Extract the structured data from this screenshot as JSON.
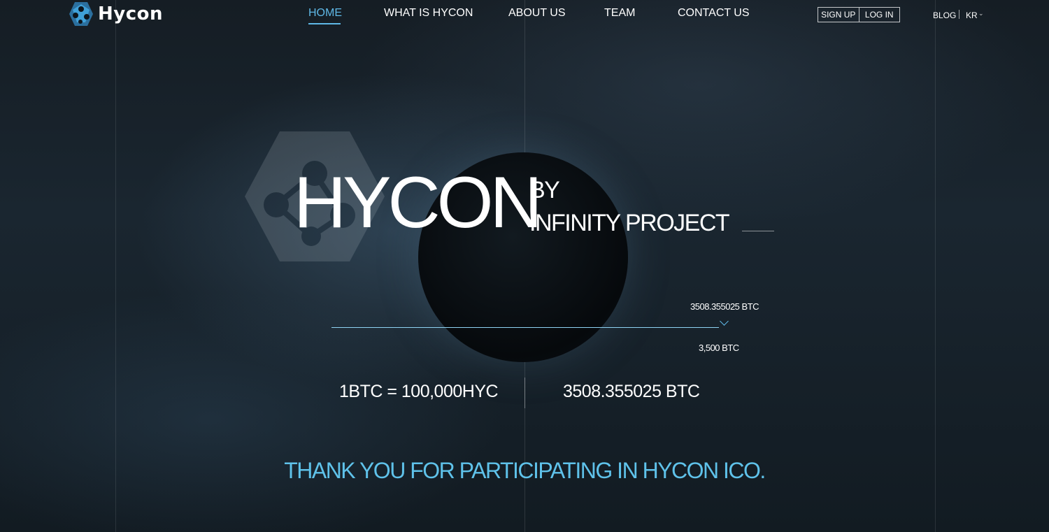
{
  "header": {
    "logo_text": "Hycon",
    "nav": [
      {
        "label": "HOME",
        "active": true
      },
      {
        "label": "WHAT IS HYCON",
        "active": false
      },
      {
        "label": "ABOUT US",
        "active": false
      },
      {
        "label": "TEAM",
        "active": false
      },
      {
        "label": "CONTACT US",
        "active": false
      }
    ],
    "sign_up": "SIGN UP",
    "log_in": "LOG IN",
    "blog": "BLOG",
    "language": "KR"
  },
  "hero": {
    "title": "HYCON",
    "by": "BY",
    "subtitle": "INFINITY PROJECT"
  },
  "progress": {
    "raised": "3508.355025 BTC",
    "goal": "3,500 BTC",
    "fraction_filled": 1.0
  },
  "stats": {
    "rate": "1BTC = 100,000HYC",
    "total": "3508.355025 BTC"
  },
  "thanks_message": "THANK YOU FOR PARTICIPATING IN HYCON ICO.",
  "colors": {
    "accent": "#5fb8e6",
    "thanks": "#5fc2ea",
    "background": "#151d24"
  }
}
